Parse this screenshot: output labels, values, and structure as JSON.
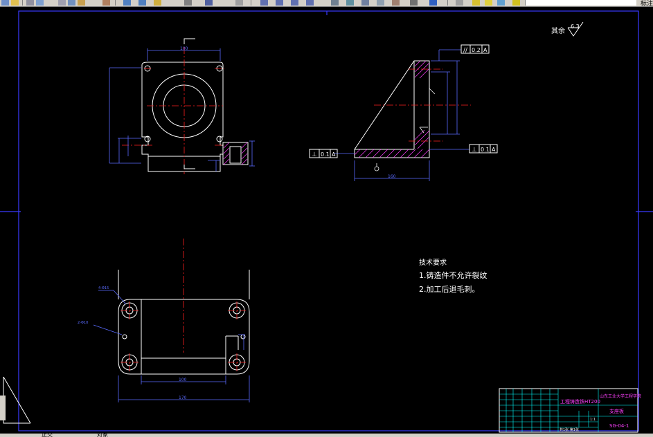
{
  "toolbar": {
    "right_label": "标注"
  },
  "statusbar": {
    "items": [
      "正交",
      "对象"
    ]
  },
  "colors": {
    "background": "#000000",
    "frame": "#3a3aff",
    "geometry": "#ffffff",
    "centerline": "#ff2020",
    "dimension": "#5a6bff",
    "hatch": "#ff40ff",
    "title_text": "#ff40ff",
    "title_grid": "#00ffff"
  },
  "drawing": {
    "roughness_note": "其余",
    "roughness_value": "6.3",
    "tolerance_parallel": {
      "symbol": "//",
      "value": "0.2",
      "datum": "A"
    },
    "tolerance_perp_right": {
      "symbol": "⊥",
      "value": "0.1",
      "datum": "A"
    },
    "tolerance_perp_left": {
      "symbol": "⊥",
      "value": "0.1",
      "datum": "A"
    },
    "tech_req_title": "技术要求",
    "tech_req_1": "1.铸造件不允许裂纹",
    "tech_req_2": "2.加工后退毛刺。",
    "dim_top_width": "100",
    "dim_side_base": "160",
    "dim_bottom_inner": "100",
    "dim_bottom_overall": "170",
    "hole_callout_1": "4-Φ15",
    "hole_callout_2": "2-Φ10"
  },
  "title_block": {
    "material": "工程铸造铁HT200",
    "school": "山东工业大学工程学院",
    "part_name": "支座板",
    "drawing_no": "SG-04-1",
    "scale": "1:1",
    "sheet": "共1张 第1张"
  }
}
